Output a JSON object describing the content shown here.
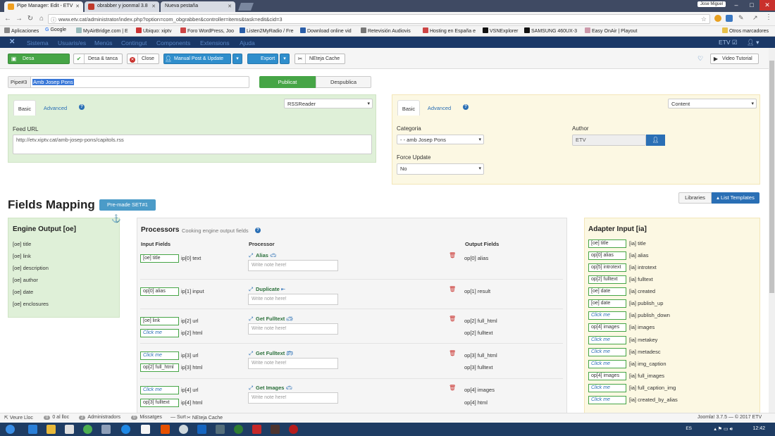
{
  "browser": {
    "tabs": [
      {
        "label": "Pipe Manager: Edit - ETV"
      },
      {
        "label": "obrabber y joonmal 3.8"
      },
      {
        "label": "Nueva pestaña"
      }
    ],
    "user": "Jose Miguel",
    "url": "www.etv.cat/administrator/index.php?option=com_obgrabber&controller=items&task=edit&cid=3",
    "bookmarks": [
      "Aplicaciones",
      "Google",
      "MyAirBridge.com | E",
      "Ubiquo: xiptv",
      "Foro WordPress, Joo",
      "Listen2MyRadio / Fre",
      "Download online vid",
      "Retevisión Audiovis",
      "Hosting en España e",
      "VSNExplorer",
      "SAMSUNG 460UX-3",
      "Easy OnAir | Playout",
      "Otros marcadores"
    ]
  },
  "jnav": {
    "items": [
      "Sistema",
      "Usuaris/es",
      "Menús",
      "Contingut",
      "Components",
      "Extensions",
      "Ajuda"
    ],
    "site": "ETV ☑",
    "user_icon": "user-icon"
  },
  "toolbar": {
    "save": "Desa",
    "save_close": "Desa & tanca",
    "close": "Close",
    "manual": "Manual Post & Update",
    "export": "Export",
    "clean": "NEteja Cache",
    "video": "Video Tutorial"
  },
  "pipe": {
    "label": "Pipe#3",
    "value": "Amb Josep Pons",
    "publish": "Publicat",
    "unpublish": "Despublica"
  },
  "left_panel": {
    "tab_basic": "Basic",
    "tab_advanced": "Advanced",
    "select": "RSSReader",
    "feed_label": "Feed URL",
    "feed_value": "http://etv.xiptv.cat/amb-josep-pons/capitols.rss"
  },
  "right_panel": {
    "tab_basic": "Basic",
    "tab_advanced": "Advanced",
    "select": "Content",
    "categoria_label": "Categoria",
    "categoria_value": "- - amb Josep Pons",
    "author_label": "Author",
    "author_value": "ETV",
    "force_label": "Force Update",
    "force_value": "No"
  },
  "mapping": {
    "title": "Fields Mapping",
    "preset": "Pre-made SET#1",
    "libraries": "Libraries",
    "templates": "List Templates"
  },
  "engine": {
    "title": "Engine Output [oe]",
    "items": [
      "[oe] title",
      "[oe] link",
      "[oe] description",
      "[oe] author",
      "[oe] date",
      "[oe] enclosures"
    ]
  },
  "processors": {
    "title": "Processors",
    "subtitle": "Cooking engine output fields",
    "col_in": "Input Fields",
    "col_proc": "Processor",
    "col_out": "Output Fields",
    "note_ph": "Write note here!",
    "rows": [
      {
        "in1": "[oe] title",
        "ip1": "ip[0] text",
        "name": "Alias",
        "out1": "op[0] alias"
      },
      {
        "in1": "op[0] alias",
        "ip1": "ip[1] input",
        "name": "Duplicate",
        "out1": "op[1] result"
      },
      {
        "in1": "[oe] link",
        "ip1": "ip[2] url",
        "in2": "Click me",
        "ip2": "ip[2] html",
        "name": "Get Fulltext",
        "out1": "op[2] full_html",
        "out2": "op[2] fulltext"
      },
      {
        "in1": "Click me",
        "ip1": "ip[3] url",
        "in2": "op[2] full_html",
        "ip2": "ip[3] html",
        "name": "Get Fulltext",
        "out1": "op[3] full_html",
        "out2": "op[3] fulltext"
      },
      {
        "in1": "Click me",
        "ip1": "ip[4] url",
        "in2": "op[3] fulltext",
        "ip2": "ip[4] html",
        "name": "Get Images",
        "out1": "op[4] images",
        "out2": "op[4] html"
      }
    ]
  },
  "adapter": {
    "title": "Adapter Input [ia]",
    "rows": [
      {
        "f": "[oe] title",
        "l": "[ia] title"
      },
      {
        "f": "op[0] alias",
        "l": "[ia] alias"
      },
      {
        "f": "op[5] introtext",
        "l": "[ia] introtext"
      },
      {
        "f": "op[2] fulltext",
        "l": "[ia] fulltext"
      },
      {
        "f": "[oe] date",
        "l": "[ia] created"
      },
      {
        "f": "[oe] date",
        "l": "[ia] publish_up"
      },
      {
        "f": "Click me",
        "l": "[ia] publish_down"
      },
      {
        "f": "op[4] images",
        "l": "[ia] images"
      },
      {
        "f": "Click me",
        "l": "[ia] metakey"
      },
      {
        "f": "Click me",
        "l": "[ia] metadesc"
      },
      {
        "f": "Click me",
        "l": "[ia] img_caption"
      },
      {
        "f": "op[4] images",
        "l": "[ia] full_images"
      },
      {
        "f": "Click me",
        "l": "[ia] full_caption_img"
      },
      {
        "f": "Click me",
        "l": "[ia] created_by_alias"
      }
    ]
  },
  "status": {
    "view_site": "Veure Lloc",
    "online": "0 al lloc",
    "admins": "Administradors",
    "messages": "Missatges",
    "logout": "Surt",
    "clean": "NEteja Cache",
    "version": "Joomla! 3.7.5 — © 2017 ETV",
    "admins_count": "2",
    "online_count": "0",
    "messages_count": "0"
  },
  "taskbar": {
    "lang": "ES",
    "clock": "12:42"
  }
}
